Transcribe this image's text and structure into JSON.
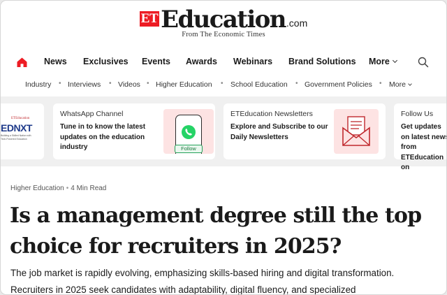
{
  "header": {
    "logo_et": "ET",
    "logo_word": "Education",
    "logo_suffix": ".com",
    "tagline": "From The Economic Times"
  },
  "main_nav": {
    "items": [
      "News",
      "Exclusives",
      "Events",
      "Awards",
      "Webinars",
      "Brand Solutions",
      "More"
    ],
    "home_icon": "home-icon",
    "search_icon": "search-icon",
    "accent_color": "#ed1c24"
  },
  "sub_nav": {
    "items": [
      "Industry",
      "Interviews",
      "Videos",
      "Higher Education",
      "School Education",
      "Government Policies",
      "More"
    ]
  },
  "cards": [
    {
      "image_text": "EDNXT",
      "image_small": "ETEducation",
      "image_caption": "Building a Skilled Nation with Tech-Powered Education"
    },
    {
      "title": "WhatsApp Channel",
      "body": "Tune in to know the latest updates on the education industry",
      "button": "Follow"
    },
    {
      "title": "ETEducation Newsletters",
      "body": "Explore and Subscribe to our Daily Newsletters"
    },
    {
      "title": "Follow Us",
      "body": "Get updates on latest news from ETEducation on"
    }
  ],
  "article": {
    "category": "Higher Education",
    "read_time": "4 Min Read",
    "headline": "Is a management degree still the top choice for recruiters in 2025?",
    "paragraph_lines": [
      "The job market is rapidly evolving, emphasizing skills-based hiring and digital transformation.",
      "Recruiters in 2025 seek candidates with adaptability, digital fluency, and specialized"
    ]
  }
}
